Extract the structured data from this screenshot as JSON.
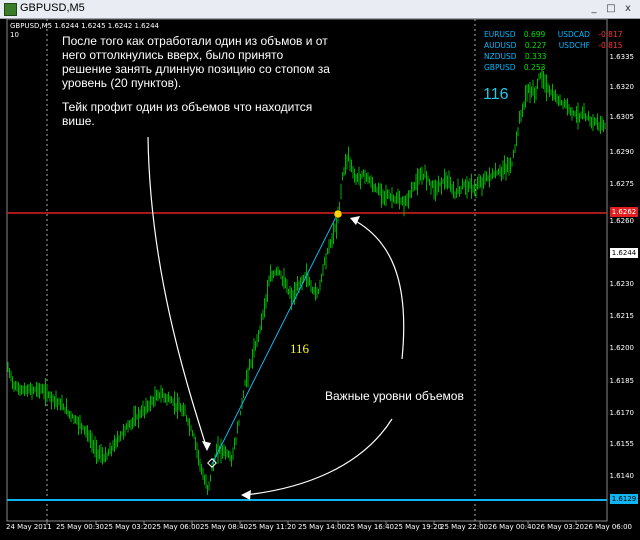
{
  "window": {
    "title": "GBPUSD,M5",
    "min_btn": "_",
    "max_btn": "□",
    "close_btn": "x"
  },
  "chart": {
    "symbol_line": "GBPUSD,M5  1.6244 1.6245 1.6242 1.6244",
    "sub_line": "10",
    "annotation_main": "После того как отработали один из объмов и от него оттолкнулись вверх, было принято решение занять длинную позицию со стопом за уровень (20 пунктов).",
    "annotation_tp": "Тейк профит один из объемов что находится више.",
    "annotation_levels": "Важные уровни объемов",
    "trade_label": "116",
    "corner_label": "116",
    "upper_level_tag": "1.6262",
    "lower_level_tag": "1.6129",
    "current_price_tag": "1.6244",
    "colors": {
      "bull": "#00b000",
      "resistance": "#e02020",
      "support": "#10b4f0",
      "trendline": "#10b4f0"
    }
  },
  "widget": {
    "rows": [
      {
        "sym": "EURUSD",
        "val": "0.699",
        "sym2": "USDCAD",
        "val2": "-0.817"
      },
      {
        "sym": "AUDUSD",
        "val": "0.227",
        "sym2": "USDCHF",
        "val2": "-0.815"
      },
      {
        "sym": "NZDUSD",
        "val": "0.333",
        "sym2": "",
        "val2": ""
      },
      {
        "sym": "GBPUSD",
        "val": "0.253",
        "sym2": "",
        "val2": ""
      }
    ]
  },
  "yaxis": {
    "labels": [
      "1.6335",
      "1.6320",
      "1.6305",
      "1.6290",
      "1.6275",
      "1.6260",
      "1.6244",
      "1.6230",
      "1.6215",
      "1.6200",
      "1.6185",
      "1.6170",
      "1.6155",
      "1.6140"
    ]
  },
  "xaxis": {
    "labels": [
      "24 May 2011",
      "25 May 00:30",
      "25 May 03:20",
      "25 May 06:00",
      "25 May 08:40",
      "25 May 11:20",
      "25 May 14:00",
      "25 May 16:40",
      "25 May 19:20",
      "25 May 22:00",
      "26 May 00:40",
      "26 May 03:20",
      "26 May 06:00"
    ]
  }
}
